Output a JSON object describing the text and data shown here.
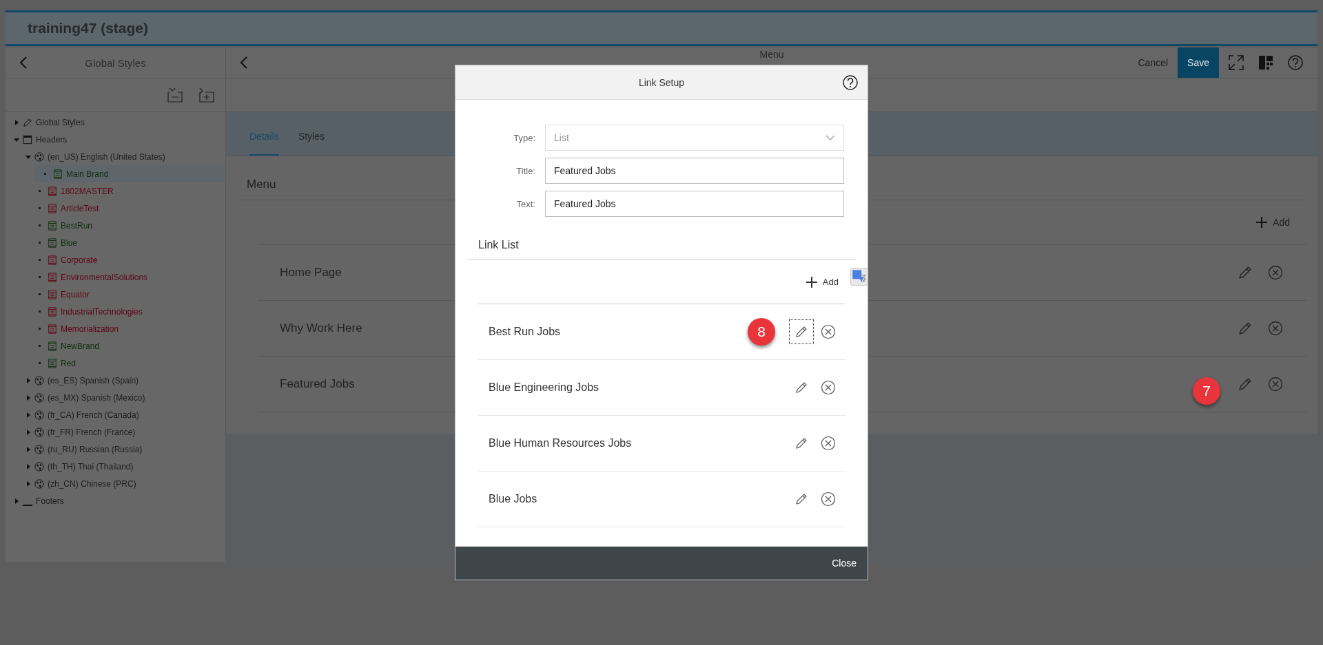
{
  "app_header": {
    "title": "training47 (stage)"
  },
  "sidebar": {
    "title": "Global Styles",
    "tree": [
      {
        "label": "Global Styles",
        "kind": "styles",
        "expanded": false
      },
      {
        "label": "Headers",
        "kind": "headers",
        "expanded": true,
        "children": [
          {
            "label": "(en_US) English (United States)",
            "kind": "locale",
            "expanded": true,
            "children": [
              {
                "label": "Main Brand",
                "kind": "brand",
                "color": "#0c2e0c",
                "selected": true
              },
              {
                "label": "1802MASTER",
                "kind": "brand",
                "color": "#5e0514",
                "selected": false
              },
              {
                "label": "ArticleTest",
                "kind": "brand",
                "color": "#5e0514",
                "selected": false
              },
              {
                "label": "BestRun",
                "kind": "brand",
                "color": "#0c2e0c",
                "selected": false
              },
              {
                "label": "Blue",
                "kind": "brand",
                "color": "#0c2e0c",
                "selected": false
              },
              {
                "label": "Corporate",
                "kind": "brand",
                "color": "#5e0514",
                "selected": false
              },
              {
                "label": "EnvironmentalSolutions",
                "kind": "brand",
                "color": "#5e0514",
                "selected": false
              },
              {
                "label": "Equator",
                "kind": "brand",
                "color": "#5e0514",
                "selected": false
              },
              {
                "label": "IndustrialTechnologies",
                "kind": "brand",
                "color": "#5e0514",
                "selected": false
              },
              {
                "label": "Memorialization",
                "kind": "brand",
                "color": "#5e0514",
                "selected": false
              },
              {
                "label": "NewBrand",
                "kind": "brand",
                "color": "#0c2e0c",
                "selected": false
              },
              {
                "label": "Red",
                "kind": "brand",
                "color": "#0c2e0c",
                "selected": false
              }
            ]
          },
          {
            "label": "(es_ES) Spanish (Spain)",
            "kind": "locale",
            "expanded": false
          },
          {
            "label": "(es_MX) Spanish (Mexico)",
            "kind": "locale",
            "expanded": false
          },
          {
            "label": "(fr_CA) French (Canada)",
            "kind": "locale",
            "expanded": false
          },
          {
            "label": "(fr_FR) French (France)",
            "kind": "locale",
            "expanded": false
          },
          {
            "label": "(ru_RU) Russian (Russia)",
            "kind": "locale",
            "expanded": false
          },
          {
            "label": "(th_TH) Thai (Thailand)",
            "kind": "locale",
            "expanded": false
          },
          {
            "label": "(zh_CN) Chinese (PRC)",
            "kind": "locale",
            "expanded": false
          }
        ]
      },
      {
        "label": "Footers",
        "kind": "footers",
        "expanded": false
      }
    ]
  },
  "toolbar": {
    "title": "Menu",
    "buttons": [
      {
        "label": "Cancel",
        "kind": "plain"
      },
      {
        "label": "Save",
        "kind": "primary"
      }
    ]
  },
  "tabs": [
    {
      "label": "Details",
      "selected": true
    },
    {
      "label": "Styles",
      "selected": false
    }
  ],
  "menu": {
    "heading": "Menu",
    "add_label": "Add",
    "items": [
      {
        "label": "Home Page"
      },
      {
        "label": "Why Work Here"
      },
      {
        "label": "Featured Jobs",
        "callout": "7"
      }
    ]
  },
  "dialog": {
    "title": "Link Setup",
    "fields": [
      {
        "label": "Type:",
        "value": "List",
        "kind": "select",
        "disabled": true
      },
      {
        "label": "Title:",
        "value": "Featured Jobs",
        "kind": "text",
        "disabled": false
      },
      {
        "label": "Text:",
        "value": "Featured Jobs",
        "kind": "text",
        "disabled": false
      }
    ],
    "section": "Link List",
    "add_label": "Add",
    "links": [
      {
        "label": "Best Run Jobs",
        "callout": "8",
        "focused": true
      },
      {
        "label": "Blue Engineering Jobs",
        "focused": false
      },
      {
        "label": "Blue Human Resources Jobs",
        "focused": false
      },
      {
        "label": "Blue Jobs",
        "focused": false
      }
    ],
    "close_label": "Close"
  }
}
